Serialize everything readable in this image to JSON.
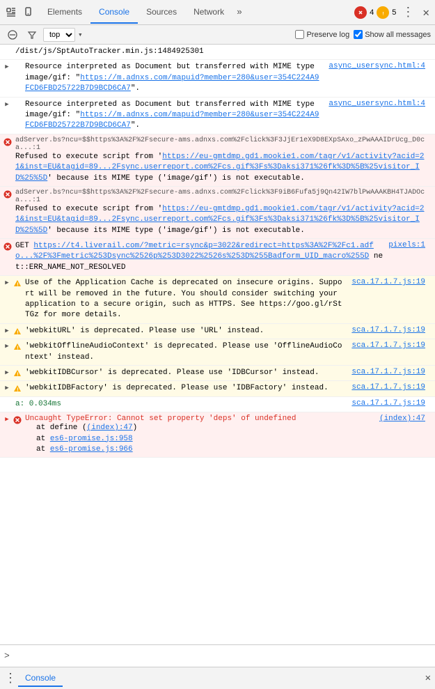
{
  "toolbar": {
    "inspect_icon": "⬚",
    "device_icon": "📱",
    "tabs": [
      "Elements",
      "Console",
      "Sources",
      "Network"
    ],
    "active_tab": "Console",
    "more_icon": "»",
    "error_count": "4",
    "warn_count": "5",
    "kebab": "⋮",
    "close": "✕"
  },
  "filter_bar": {
    "block_icon": "🚫",
    "filter_icon": "▽",
    "level": "top",
    "dropdown_arrow": "▾",
    "preserve_log": "Preserve log",
    "show_all": "Show all messages"
  },
  "log_entries": [
    {
      "type": "info",
      "has_expand": false,
      "icon": "",
      "text": "/dist/js/SptAutoTracker.min.js:1484925301",
      "source": ""
    },
    {
      "type": "info",
      "has_expand": true,
      "icon": "",
      "text": "Resource interpreted as Document but transferred with MIME type image/gif: \"https://m.adnxs.com/mapuid?member=280&user=354C224A9FCD6FBD25722B7D9BCD6CA7\".",
      "source": "async_usersync.html:4",
      "has_link": true,
      "link_text": "https://m.adnxs.com/mapuid?member=280&user=354C224A9FCD6FBD25722B7D9BCD6CA7"
    },
    {
      "type": "info",
      "has_expand": true,
      "icon": "",
      "text": "Resource interpreted as Document but transferred with MIME type image/gif: \"https://m.adnxs.com/mapuid?member=280&user=354C224A9FCD6FBD25722B7D9BCD6CA7\".",
      "source": "async_usersync.html:4",
      "has_link": true,
      "link_text": "https://m.adnxs.com/mapuid?member=280&user=354C224A9FCD6FBD25722B7D9BCD6CA7"
    },
    {
      "type": "error",
      "has_expand": false,
      "icon": "✕",
      "source_right": "adServer.bs?ncu=$$https%3A%2F%2Fsecure-ams.adnxs.com%2Fclick%3F3JjEr1eX9D8EXpSAxo_zPwAAAIDrUcg_D0ca...:1",
      "text_main": "Refused to execute script from 'https://eu-gmtdmp.gd1.mookie1.com/tagr/v1/activity?acid=21&inst=EU&tagid=89...2Fsync.userreport.com%2Fcs.gif%3Fs%3Daksi371%26fk%3D%5B%25visitor_ID%25%5D' because its MIME type ('image/gif') is not executable."
    },
    {
      "type": "error",
      "has_expand": false,
      "icon": "✕",
      "source_right": "adServer.bs?ncu=$$https%3A%2F%2Fsecure-ams.adnxs.com%2Fclick%3F9iB6Fufa5j9Qn42IW7blPwAAAKBH4TJADOca...:1",
      "text_main": "Refused to execute script from 'https://eu-gmtdmp.gd1.mookie1.com/tagr/v1/activity?acid=21&inst=EU&tagid=89...2Fsync.userreport.com%2Fcs.gif%3Fs%3Daksi371%26fk%3D%5B%25visitor_ID%25%5D' because its MIME type ('image/gif') is not executable."
    },
    {
      "type": "error",
      "has_expand": false,
      "icon": "✕",
      "source_right": "pixels:1",
      "text_main": "GET https://t4.liverail.com/?metric=rsync&p=3022&redirect=https%3A%2F%2Fc1.adfo...%2F%3Fmetric%253Dsync%2526p%253D3022%2526s%253D%255Badform_UID_macro%255D net::ERR_NAME_NOT_RESOLVED"
    },
    {
      "type": "warning",
      "has_expand": true,
      "icon": "▲",
      "text": "Use of the Application Cache is deprecated on insecure origins. Support will be removed in the future. You should consider switching your application to a secure origin, such as HTTPS. See https://goo.gl/rStTGz for more details.",
      "source": "sca.17.1.7.js:19"
    },
    {
      "type": "warning",
      "has_expand": true,
      "icon": "▲",
      "text": "'webkitURL' is deprecated. Please use 'URL' instead.",
      "source": "sca.17.1.7.js:19"
    },
    {
      "type": "warning",
      "has_expand": true,
      "icon": "▲",
      "text": "'webkitOfflineAudioContext' is deprecated. Please use 'OfflineAudioContext' instead.",
      "source": "sca.17.1.7.js:19"
    },
    {
      "type": "warning",
      "has_expand": true,
      "icon": "▲",
      "text": "'webkitIDBCursor' is deprecated. Please use 'IDBCursor' instead.",
      "source": "sca.17.1.7.js:19"
    },
    {
      "type": "warning",
      "has_expand": true,
      "icon": "▲",
      "text": "'webkitIDBFactory' is deprecated. Please use 'IDBFactory' instead.",
      "source": "sca.17.1.7.js:19"
    },
    {
      "type": "info-green",
      "has_expand": false,
      "icon": "",
      "text": "a: 0.034ms",
      "source": "sca.17.1.7.js:19"
    },
    {
      "type": "error",
      "has_expand": true,
      "icon": "✕",
      "text_main": "Uncaught TypeError: Cannot set property 'deps' of undefined",
      "source": "(index):47",
      "sub_lines": [
        "at define ((index):47)",
        "at es6-promise.js:958",
        "at es6-promise.js:966"
      ]
    }
  ],
  "console_input": {
    "prompt": ">",
    "placeholder": ""
  },
  "bottom_bar": {
    "dots": "⋮",
    "tab": "Console",
    "close": "✕"
  }
}
